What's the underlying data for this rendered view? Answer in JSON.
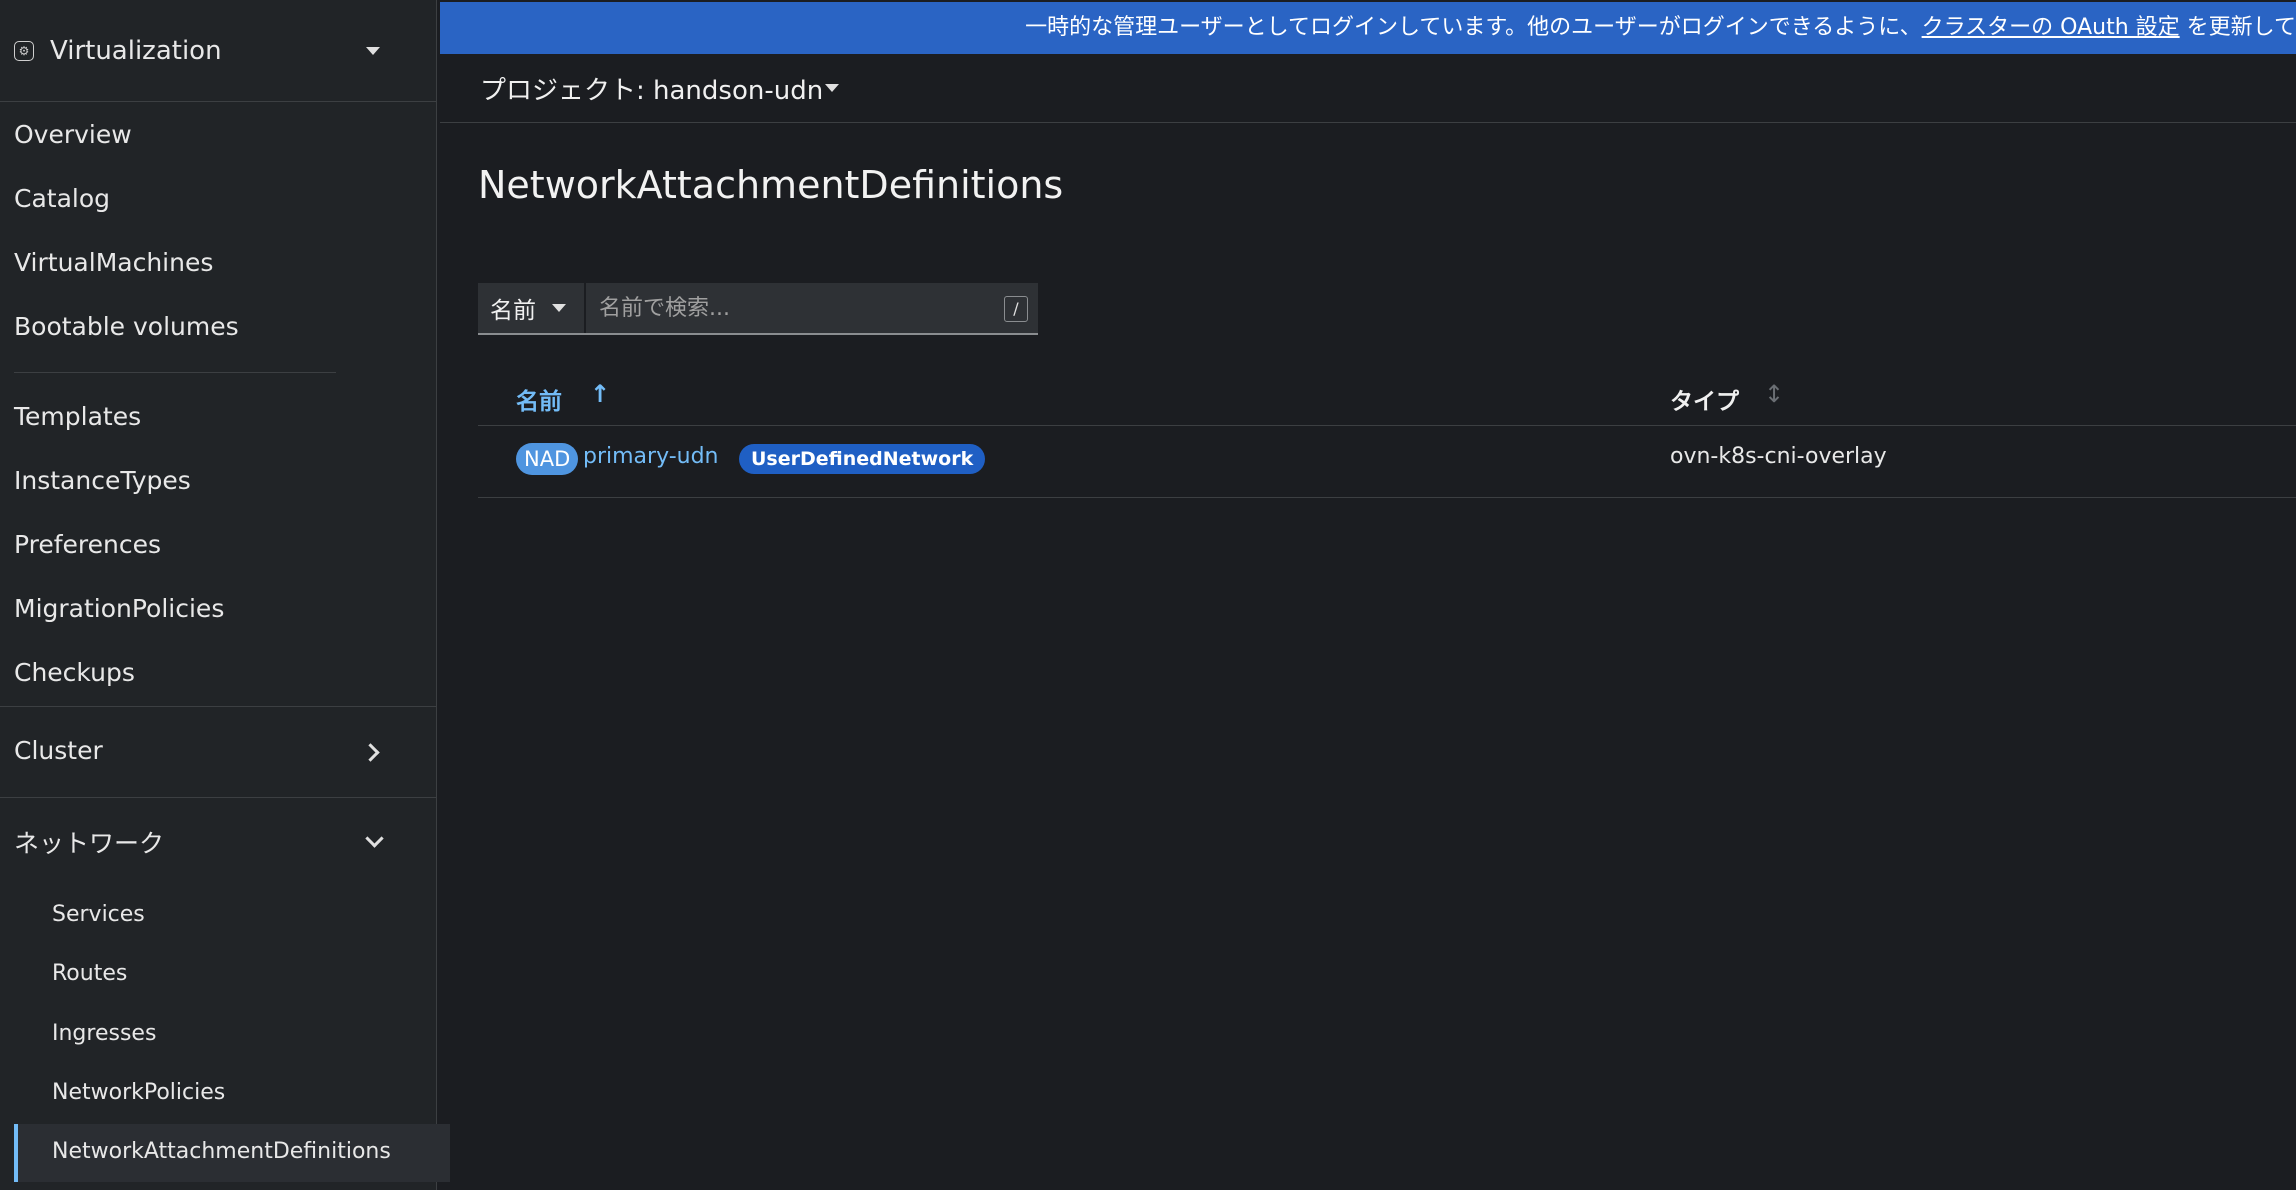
{
  "perspective": {
    "icon": "virtualization-icon",
    "label": "Virtualization"
  },
  "sidebar": {
    "items": [
      {
        "label": "Overview"
      },
      {
        "label": "Catalog"
      },
      {
        "label": "VirtualMachines"
      },
      {
        "label": "Bootable volumes"
      },
      {
        "label": "Templates"
      },
      {
        "label": "InstanceTypes"
      },
      {
        "label": "Preferences"
      },
      {
        "label": "MigrationPolicies"
      },
      {
        "label": "Checkups"
      }
    ],
    "cluster": {
      "label": "Cluster"
    },
    "network": {
      "label": "ネットワーク",
      "children": [
        {
          "label": "Services"
        },
        {
          "label": "Routes"
        },
        {
          "label": "Ingresses"
        },
        {
          "label": "NetworkPolicies"
        },
        {
          "label": "NetworkAttachmentDefinitions"
        }
      ]
    }
  },
  "banner": {
    "text_before": "一時的な管理ユーザーとしてログインしています。他のユーザーがログインできるように、",
    "link": "クラスターの OAuth 設定",
    "text_after": " を更新して"
  },
  "project": {
    "label": "プロジェクト: handson-udn"
  },
  "page": {
    "title": "NetworkAttachmentDefinitions"
  },
  "filter": {
    "selected": "名前",
    "placeholder": "名前で検索...",
    "shortcut": "/"
  },
  "table": {
    "headers": {
      "name": "名前",
      "type": "タイプ"
    },
    "rows": [
      {
        "badge": "NAD",
        "name": "primary-udn",
        "label": "UserDefinedNetwork",
        "type": "ovn-k8s-cni-overlay"
      }
    ]
  },
  "colors": {
    "accent": "#73bcf7",
    "banner": "#2a64c4",
    "label_blue": "#1f5fc4"
  }
}
